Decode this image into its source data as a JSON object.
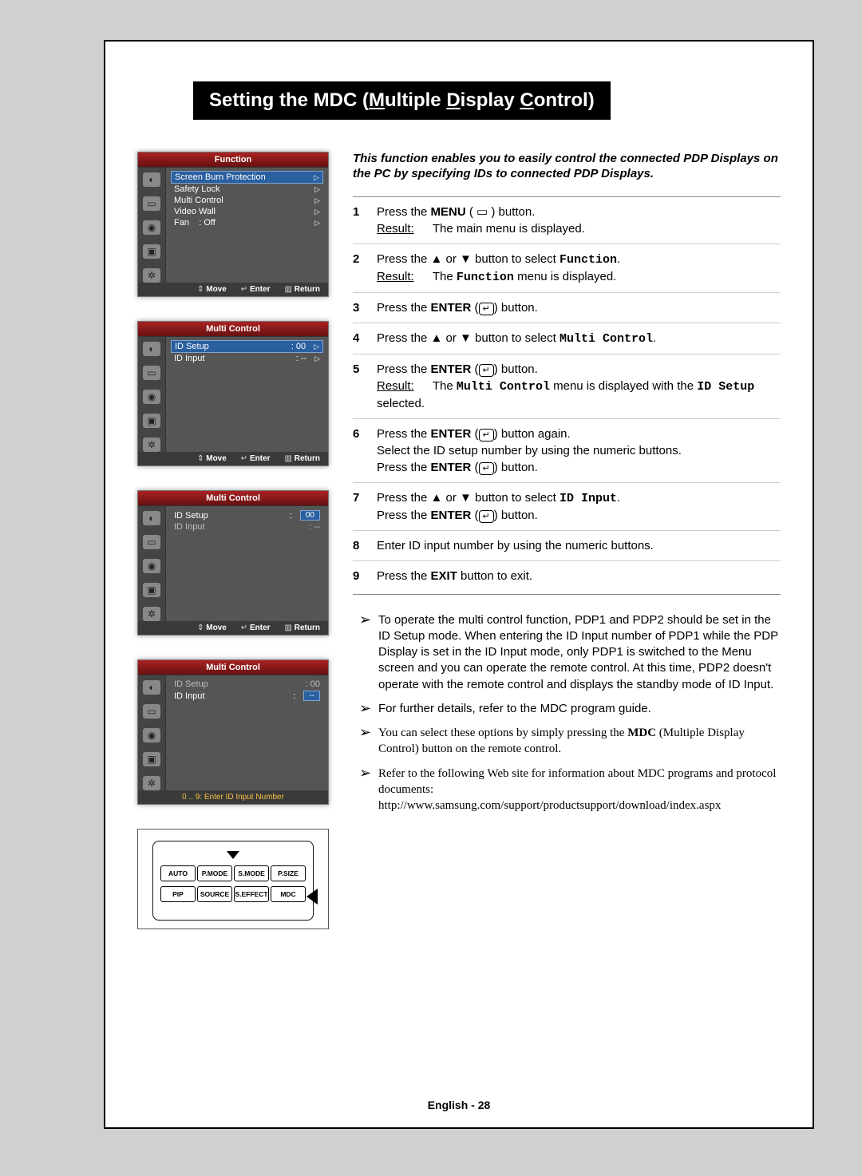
{
  "title_parts": [
    "Setting the MDC (",
    "M",
    "ultiple ",
    "D",
    "isplay ",
    "C",
    "ontrol)"
  ],
  "intro": "This function enables you to easily control the connected PDP Displays on the PC by specifying IDs to connected PDP Displays.",
  "result_label": "Result:",
  "steps": [
    {
      "n": "1",
      "body": "Press the <b>MENU</b> ( ▭ ) button.",
      "result": "The main menu is displayed."
    },
    {
      "n": "2",
      "body": "Press the ▲ or ▼ button to select <span class='mono'><b>Function</b></span>.",
      "result": "The <span class='mono'><b>Function</b></span> menu is displayed."
    },
    {
      "n": "3",
      "body": "Press the <b>ENTER</b> (<span class='enter-glyph'>↵</span>) button."
    },
    {
      "n": "4",
      "body": "Press the ▲ or ▼ button to select <span class='mono'><b>Multi Control</b></span>."
    },
    {
      "n": "5",
      "body": "Press the <b>ENTER</b> (<span class='enter-glyph'>↵</span>) button.",
      "result": "The <span class='mono'><b>Multi Control</b></span> menu is displayed with the <span class='mono'><b>ID Setup</b></span> selected."
    },
    {
      "n": "6",
      "body": "Press the <b>ENTER</b> (<span class='enter-glyph'>↵</span>) button again.<br>Select the ID setup number by using the numeric buttons.<br>Press the <b>ENTER</b> (<span class='enter-glyph'>↵</span>) button."
    },
    {
      "n": "7",
      "body": "Press the ▲ or ▼ button to select <span class='mono'><b>ID Input</b></span>.<br>Press the <b>ENTER</b> (<span class='enter-glyph'>↵</span>) button."
    },
    {
      "n": "8",
      "body": "Enter ID input number by using the numeric buttons."
    },
    {
      "n": "9",
      "body": "Press the <b>EXIT</b> button to exit."
    }
  ],
  "notes": [
    {
      "text": "To operate the multi control function, PDP1 and PDP2 should be set in the ID Setup mode. When entering the ID Input number of PDP1 while the PDP Display is set in the ID Input mode, only PDP1 is switched to the Menu screen and you can operate the remote control. At this time, PDP2 doesn't operate with the remote control and displays the standby mode of ID Input.",
      "serif": false
    },
    {
      "text": "For further details, refer to the MDC program guide.",
      "serif": false
    },
    {
      "text": "You can select these options by simply pressing the <b>MDC</b> (Multiple Display Control) button on the remote control.",
      "serif": true
    },
    {
      "text": "Refer to the following Web site for information about MDC programs and protocol documents:<br>http://www.samsung.com/support/productsupport/download/index.aspx",
      "serif": true
    }
  ],
  "osd": {
    "foot": {
      "move": "Move",
      "enter": "Enter",
      "return": "Return"
    },
    "panel1": {
      "title": "Function",
      "rows": [
        {
          "label": "Screen Burn Protection",
          "val": "",
          "hi": true,
          "tri": true
        },
        {
          "label": "Safety Lock",
          "val": "",
          "tri": true
        },
        {
          "label": "Multi Control",
          "val": "",
          "tri": true
        },
        {
          "label": "Video Wall",
          "val": "",
          "tri": true
        },
        {
          "label": "Fan",
          "val": ": Off",
          "tri": true
        }
      ]
    },
    "panel2": {
      "title": "Multi Control",
      "rows": [
        {
          "label": "ID Setup",
          "val": ":   00",
          "hi": true,
          "tri": true
        },
        {
          "label": "ID Input",
          "val": ":   --",
          "tri": true
        }
      ]
    },
    "panel3": {
      "title": "Multi Control",
      "rows": [
        {
          "label": "ID Setup",
          "val_box": "00",
          "pre": ":"
        },
        {
          "label": "ID Input",
          "val": ":   --"
        }
      ]
    },
    "panel4": {
      "title": "Multi Control",
      "rows": [
        {
          "label": "ID Setup",
          "val": ":   00",
          "dim": true
        },
        {
          "label": "ID Input",
          "val_box": "--",
          "pre": ":"
        }
      ],
      "foot_alt": "0 .. 9: Enter ID Input Number"
    }
  },
  "remote": {
    "row1": [
      "AUTO",
      "P.MODE",
      "S.MODE",
      "P.SIZE"
    ],
    "row2": [
      "PIP",
      "SOURCE",
      "S.EFFECT",
      "MDC"
    ]
  },
  "footer": "English - 28"
}
